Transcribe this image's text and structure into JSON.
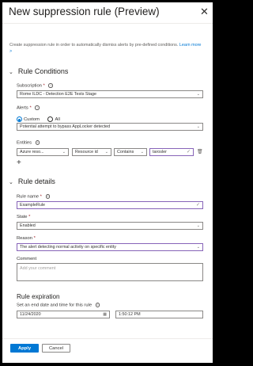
{
  "header": {
    "title": "New suppression rule (Preview)",
    "close_icon": "close-icon"
  },
  "description": {
    "text": "Create suppression rule in order to automatically dismiss alerts by pre-defined conditions.",
    "link": "Learn more >"
  },
  "rule_conditions": {
    "title": "Rule Conditions",
    "subscription": {
      "label": "Subscription",
      "value": "Rome ILDC - Detection E2E Tests Stage"
    },
    "alerts": {
      "label": "Alerts",
      "options": [
        "Custom",
        "All"
      ],
      "selected": "Custom",
      "value": "Potential attempt to bypass AppLocker detected"
    },
    "entities": {
      "label": "Entities",
      "type": "Azure reso...",
      "field": "Resource id",
      "operator": "Contains",
      "value": "tarosler",
      "add_icon": "plus-icon"
    }
  },
  "rule_details": {
    "title": "Rule details",
    "rule_name": {
      "label": "Rule name",
      "value": "ExampleRule"
    },
    "state": {
      "label": "State",
      "value": "Enabled"
    },
    "reason": {
      "label": "Reason",
      "value": "The alert detecting normal activity on specific entity"
    },
    "comment": {
      "label": "Comment",
      "placeholder": "Add your comment"
    }
  },
  "expiration": {
    "title": "Rule expiration",
    "subtitle": "Set an end date and time for this rule",
    "date": "11/24/2020",
    "time": "1:50:12 PM"
  },
  "footer": {
    "apply": "Apply",
    "cancel": "Cancel"
  }
}
